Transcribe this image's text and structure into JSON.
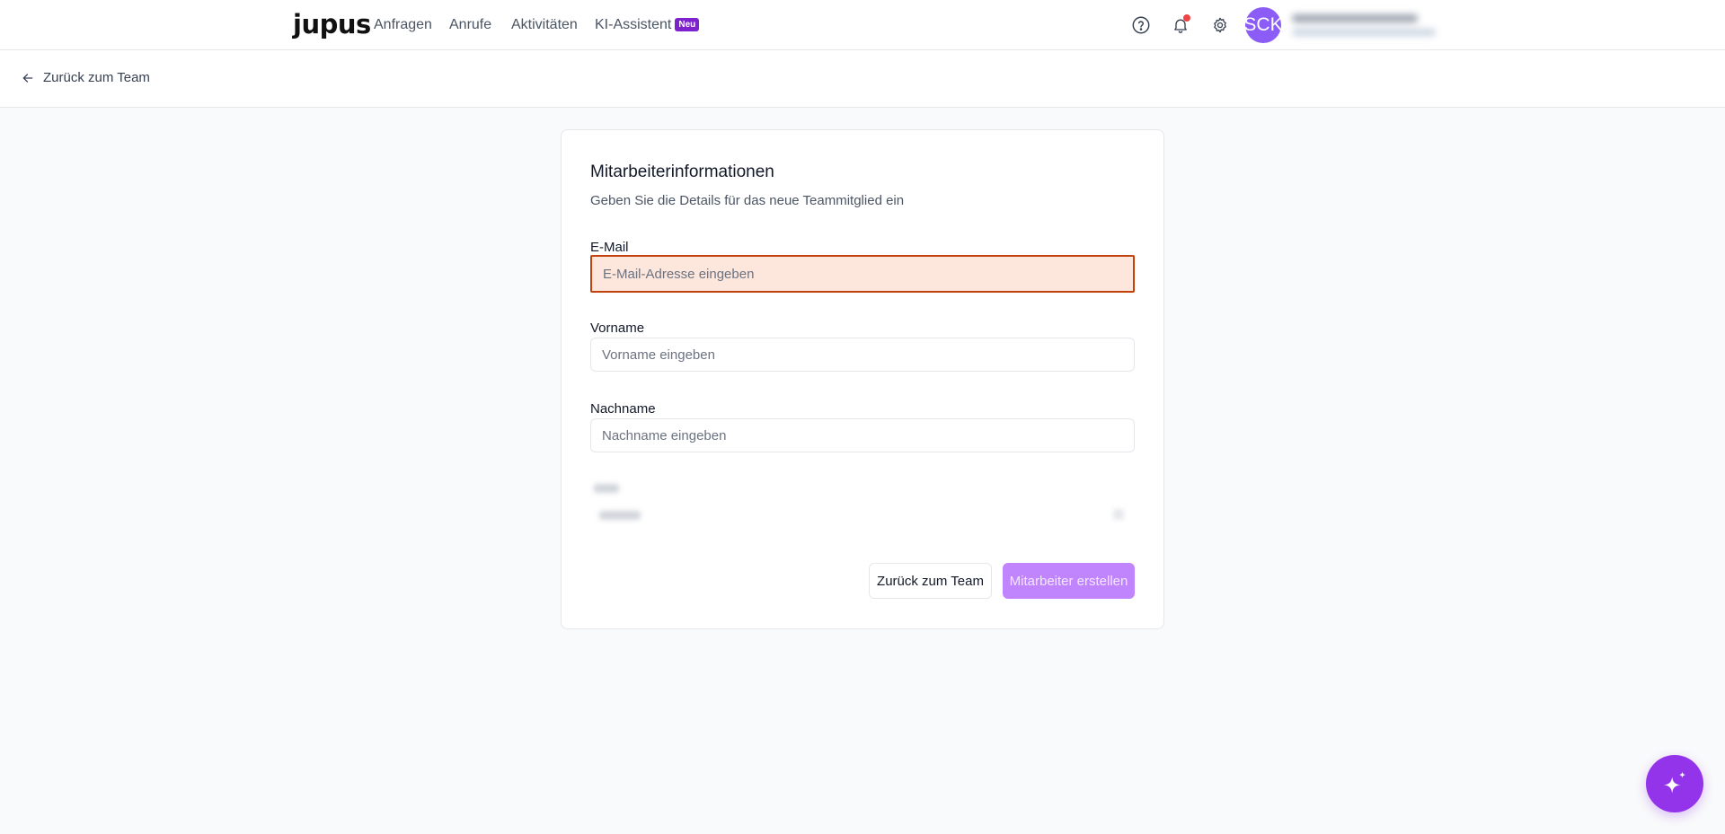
{
  "header": {
    "logo": "jupus",
    "nav": [
      {
        "label": "Anfragen"
      },
      {
        "label": "Anrufe"
      },
      {
        "label": "Aktivitäten"
      },
      {
        "label": "KI-Assistent",
        "badge": "Neu"
      }
    ],
    "icons": [
      "help-icon",
      "bell-icon",
      "gear-icon"
    ],
    "avatar_initials": "SCK"
  },
  "back_link": {
    "label": "Zurück zum Team"
  },
  "form": {
    "title": "Mitarbeiterinformationen",
    "subtitle": "Geben Sie die Details für das neue Teammitglied ein",
    "fields": {
      "email": {
        "label": "E-Mail",
        "placeholder": "E-Mail-Adresse eingeben",
        "value": ""
      },
      "first_name": {
        "label": "Vorname",
        "placeholder": "Vorname eingeben",
        "value": ""
      },
      "last_name": {
        "label": "Nachname",
        "placeholder": "Nachname eingeben",
        "value": ""
      }
    },
    "buttons": {
      "back": "Zurück zum Team",
      "submit": "Mitarbeiter erstellen"
    }
  },
  "colors": {
    "accent": "#9333ea",
    "error_border": "#c2410c",
    "error_bg": "#fde6dc",
    "notification_dot": "#ef4444"
  }
}
